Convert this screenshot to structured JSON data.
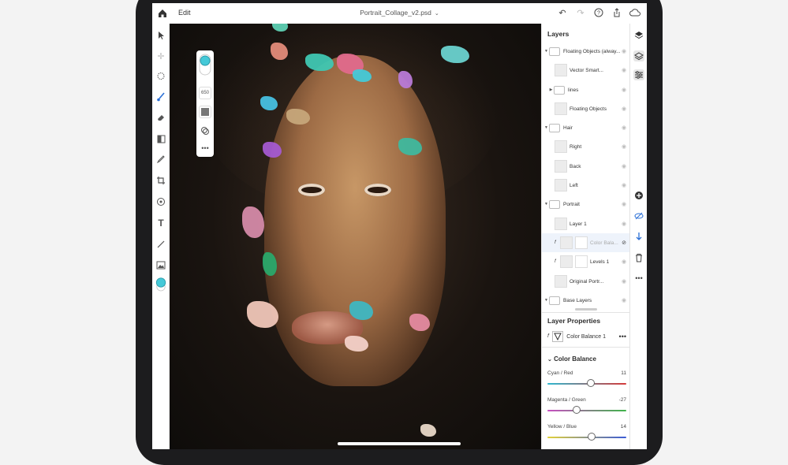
{
  "topbar": {
    "edit_label": "Edit",
    "document_title": "Portrait_Collage_v2.psd",
    "title_caret": "⌄",
    "icons": [
      "home-icon",
      "undo-icon",
      "redo-icon",
      "help-icon",
      "share-icon",
      "cloud-icon"
    ]
  },
  "left_tools": [
    "select-icon",
    "move-icon",
    "lasso-icon",
    "brush-icon",
    "eraser-icon",
    "gradient-icon",
    "eyedropper-icon",
    "crop-icon",
    "clone-icon",
    "type-icon",
    "line-icon",
    "image-icon",
    "color-icon"
  ],
  "float_panel": {
    "size_label": "650"
  },
  "layers_panel": {
    "title": "Layers",
    "layers": [
      {
        "name": "Floating Objects (alway...",
        "type": "group",
        "expanded": true
      },
      {
        "name": "Vector Smart...",
        "type": "layer"
      },
      {
        "name": "lines",
        "type": "group",
        "expanded": false
      },
      {
        "name": "Floating Objects",
        "type": "layer"
      },
      {
        "name": "Hair",
        "type": "group",
        "expanded": true
      },
      {
        "name": "Right",
        "type": "layer"
      },
      {
        "name": "Back",
        "type": "layer"
      },
      {
        "name": "Left",
        "type": "layer"
      },
      {
        "name": "Portrait",
        "type": "group",
        "expanded": true
      },
      {
        "name": "Layer 1",
        "type": "layer"
      },
      {
        "name": "Color Bala...",
        "type": "adjustment",
        "selected": true,
        "hidden": true
      },
      {
        "name": "Levels 1",
        "type": "adjustment"
      },
      {
        "name": "Original Portr...",
        "type": "layer"
      },
      {
        "name": "Base Layers",
        "type": "group",
        "expanded": true
      }
    ]
  },
  "layer_properties": {
    "title": "Layer Properties",
    "layer_name": "Color Balance 1",
    "more": "•••"
  },
  "color_balance": {
    "title": "Color Balance",
    "sliders": [
      {
        "label": "Cyan / Red",
        "value": "11",
        "level": 0.55,
        "colors": [
          "#2fb8d0",
          "#d63a3a"
        ]
      },
      {
        "label": "Magenta / Green",
        "value": "-27",
        "level": 0.37,
        "colors": [
          "#c84fc2",
          "#3fb54a"
        ]
      },
      {
        "label": "Yellow / Blue",
        "value": "14",
        "level": 0.56,
        "colors": [
          "#e3d23a",
          "#3a5bd6"
        ]
      }
    ]
  },
  "right_rail": [
    "layers-icon",
    "layer-properties-icon",
    "adjustments-icon",
    "add-icon",
    "visibility-icon",
    "arrange-icon",
    "delete-icon",
    "more-icon"
  ],
  "colors": {
    "accent": "#45c9d8",
    "panel_bg": "#ffffff",
    "canvas_bg": "#1a1410"
  }
}
